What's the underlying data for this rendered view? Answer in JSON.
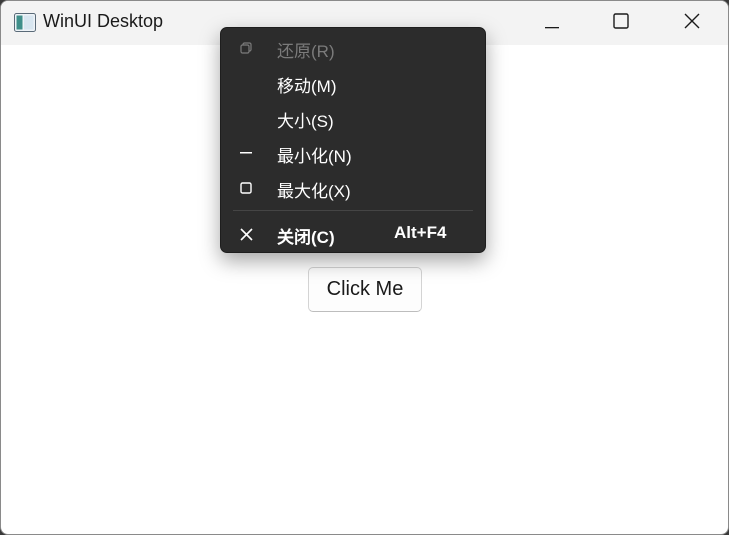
{
  "window": {
    "title": "WinUI Desktop",
    "icon": "app-window-icon",
    "caption_buttons": [
      "minimize-icon",
      "maximize-icon",
      "close-icon"
    ]
  },
  "content": {
    "button_label": "Click Me"
  },
  "system_menu": {
    "items": [
      {
        "label": "还原(R)",
        "icon": "restore-icon",
        "disabled": true
      },
      {
        "label": "移动(M)",
        "icon": "",
        "disabled": false
      },
      {
        "label": "大小(S)",
        "icon": "",
        "disabled": false
      },
      {
        "label": "最小化(N)",
        "icon": "minimize-icon",
        "disabled": false
      },
      {
        "label": "最大化(X)",
        "icon": "maximize-icon",
        "disabled": false
      },
      {
        "label": "关闭(C)",
        "icon": "close-icon",
        "shortcut": "Alt+F4",
        "disabled": false
      }
    ]
  },
  "colors": {
    "menu_background": "#2c2c2c",
    "titlebar_background": "#f3f3f3",
    "disabled_text": "#7b7b7b"
  }
}
